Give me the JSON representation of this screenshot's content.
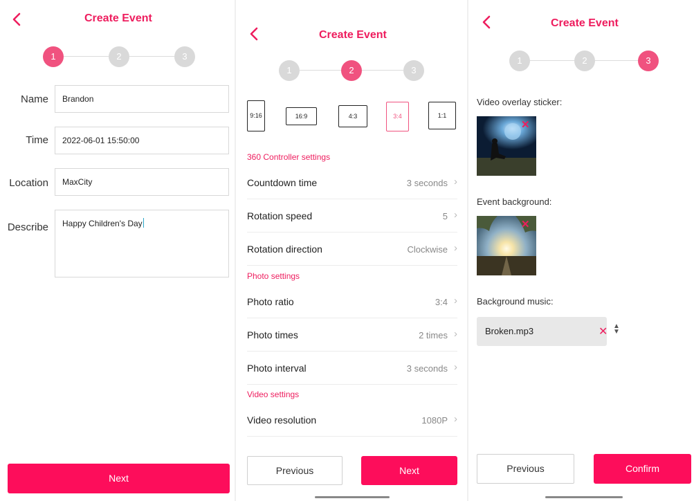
{
  "colors": {
    "accent": "#fd0d5b",
    "accent_text": "#ee1d5e",
    "step_active": "#f0527f",
    "step_inactive": "#d9d9d9"
  },
  "panel1": {
    "title": "Create Event",
    "steps": [
      "1",
      "2",
      "3"
    ],
    "active_step": 1,
    "form": {
      "name_label": "Name",
      "name_value": "Brandon",
      "time_label": "Time",
      "time_value": "2022-06-01 15:50:00",
      "location_label": "Location",
      "location_value": "MaxCity",
      "describe_label": "Describe",
      "describe_value": "Happy Children's Day"
    },
    "next_label": "Next"
  },
  "panel2": {
    "title": "Create Event",
    "steps": [
      "1",
      "2",
      "3"
    ],
    "active_step": 2,
    "ratios": [
      "9:16",
      "16:9",
      "4:3",
      "3:4",
      "1:1"
    ],
    "selected_ratio": "3:4",
    "sections": {
      "controller": "360 Controller settings",
      "photo": "Photo settings",
      "video": "Video settings"
    },
    "rows": {
      "countdown": {
        "label": "Countdown time",
        "value": "3 seconds"
      },
      "rotation_speed": {
        "label": "Rotation speed",
        "value": "5"
      },
      "rotation_direction": {
        "label": "Rotation direction",
        "value": "Clockwise"
      },
      "photo_ratio": {
        "label": "Photo ratio",
        "value": "3:4"
      },
      "photo_times": {
        "label": "Photo times",
        "value": "2 times"
      },
      "photo_interval": {
        "label": "Photo interval",
        "value": "3 seconds"
      },
      "video_resolution": {
        "label": "Video resolution",
        "value": "1080P"
      }
    },
    "previous_label": "Previous",
    "next_label": "Next"
  },
  "panel3": {
    "title": "Create Event",
    "steps": [
      "1",
      "2",
      "3"
    ],
    "active_step": 3,
    "video_overlay_label": "Video overlay sticker:",
    "event_background_label": "Event background:",
    "background_music_label": "Background music:",
    "music_file": "Broken.mp3",
    "previous_label": "Previous",
    "confirm_label": "Confirm"
  },
  "icons": {
    "back": "chevron-left-icon",
    "chevron": "›",
    "remove": "✕",
    "sort": "sort-icon"
  }
}
